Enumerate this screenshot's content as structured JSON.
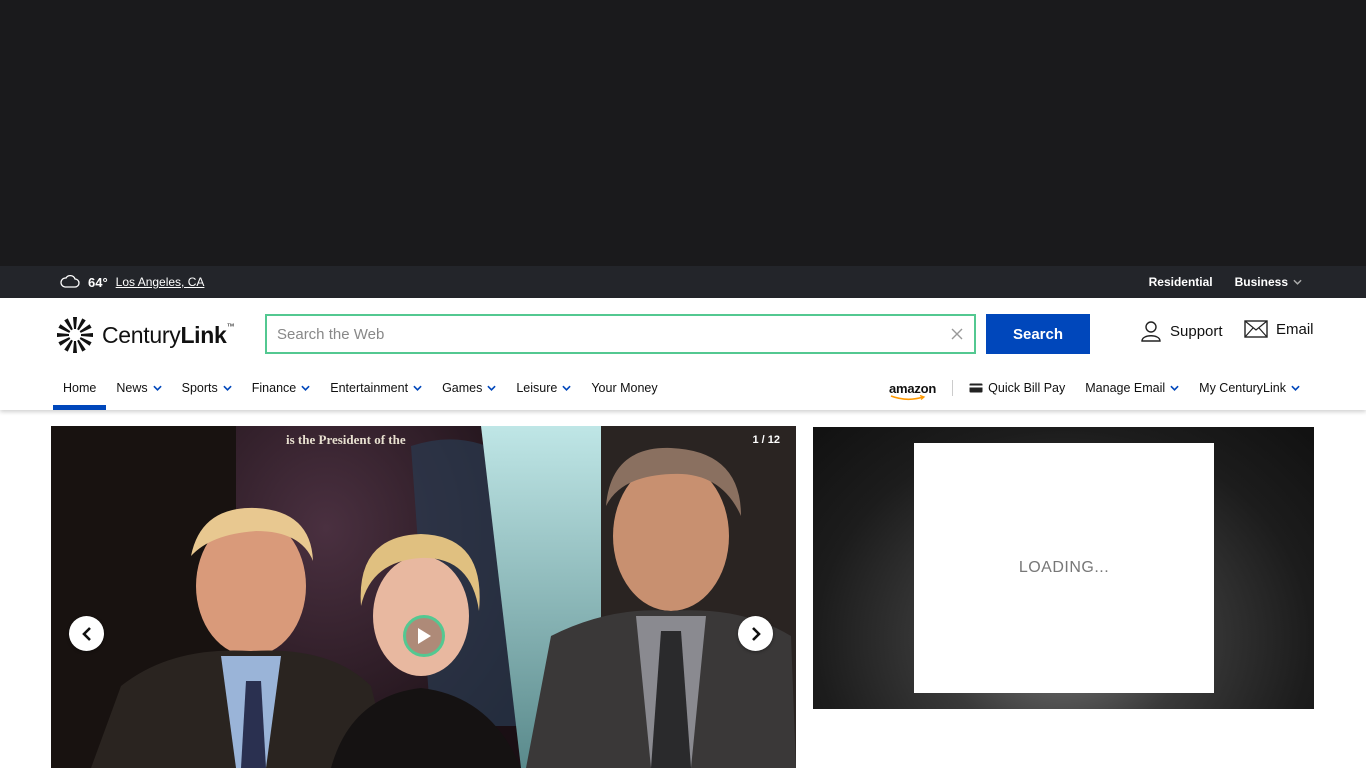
{
  "weather": {
    "temperature": "64°",
    "location": "Los Angeles, CA",
    "icon": "cloud-icon"
  },
  "topbar": {
    "residential": "Residential",
    "business": "Business"
  },
  "brand": {
    "name_light": "Century",
    "name_bold": "Link",
    "tm": "™"
  },
  "search": {
    "placeholder": "Search the Web",
    "button": "Search",
    "value": ""
  },
  "header_links": {
    "support": "Support",
    "email": "Email"
  },
  "nav": {
    "items": [
      {
        "label": "Home",
        "dropdown": false,
        "active": true
      },
      {
        "label": "News",
        "dropdown": true
      },
      {
        "label": "Sports",
        "dropdown": true
      },
      {
        "label": "Finance",
        "dropdown": true
      },
      {
        "label": "Entertainment",
        "dropdown": true
      },
      {
        "label": "Games",
        "dropdown": true
      },
      {
        "label": "Leisure",
        "dropdown": true
      },
      {
        "label": "Your Money",
        "dropdown": false
      }
    ],
    "right": {
      "amazon": "amazon",
      "quick_bill_pay": "Quick Bill Pay",
      "manage_email": "Manage Email",
      "my_centurylink": "My CenturyLink"
    }
  },
  "slideshow": {
    "counter": "1 / 12",
    "poster_text": "is the President of the"
  },
  "ad": {
    "loading": "LOADING..."
  },
  "colors": {
    "accent": "#0047bb",
    "search_border": "#53c891",
    "topbar": "#23252a",
    "ad_bg": "#1a1a1c"
  }
}
